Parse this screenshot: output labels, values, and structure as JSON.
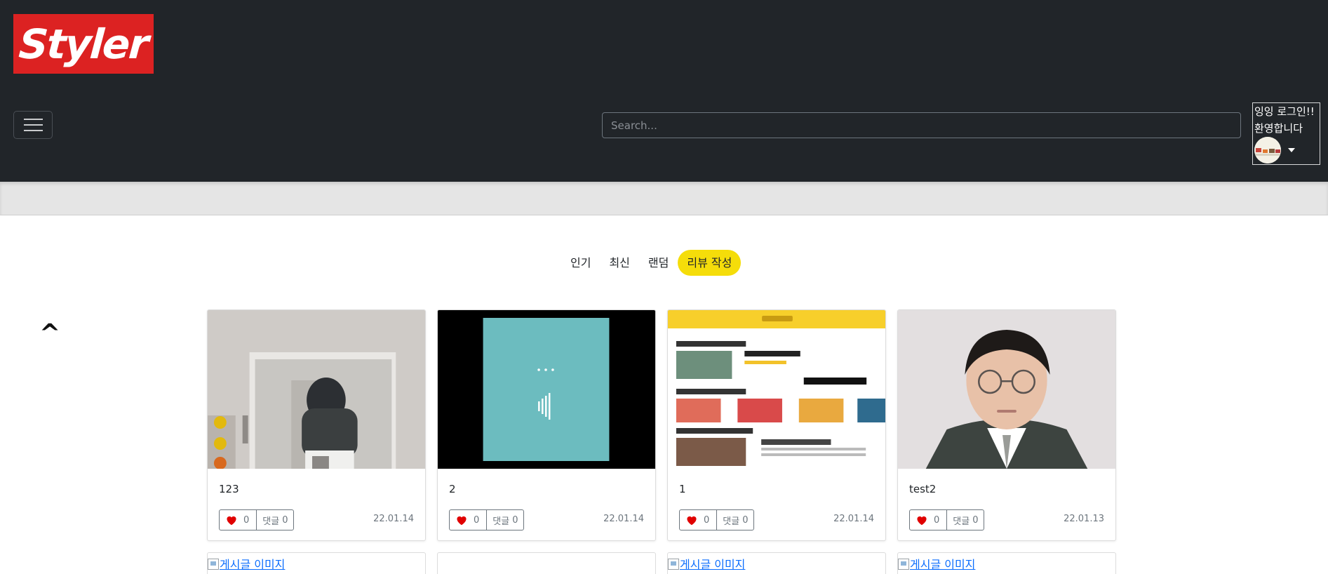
{
  "header": {
    "logo_text": "Styler",
    "search_placeholder": "Search...",
    "user_greeting_line1": "잉잉 로그인!!",
    "user_greeting_line2": "환영합니다"
  },
  "sort_tabs": [
    {
      "label": "인기",
      "active": false
    },
    {
      "label": "최신",
      "active": false
    },
    {
      "label": "랜덤",
      "active": false
    },
    {
      "label": "리뷰 작성",
      "active": true
    }
  ],
  "scroll_top_label": "^",
  "posts": [
    {
      "title": "123",
      "likes": "0",
      "comment_label": "댓글",
      "comments": "0",
      "date": "22.01.14"
    },
    {
      "title": "2",
      "likes": "0",
      "comment_label": "댓글",
      "comments": "0",
      "date": "22.01.14"
    },
    {
      "title": "1",
      "likes": "0",
      "comment_label": "댓글",
      "comments": "0",
      "date": "22.01.14"
    },
    {
      "title": "test2",
      "likes": "0",
      "comment_label": "댓글",
      "comments": "0",
      "date": "22.01.13"
    }
  ],
  "next_row": [
    {
      "alt_text": "게시글 이미지"
    },
    {
      "alt_text": ""
    },
    {
      "alt_text": "게시글 이미지"
    },
    {
      "alt_text": "게시글 이미지"
    }
  ],
  "colors": {
    "navbar": "#212529",
    "logo_bg": "#dc2222",
    "active_tab": "#f5dd0a",
    "heart": "#e00000",
    "link": "#0d6efd"
  },
  "icons": {
    "menu": "hamburger-icon",
    "like": "heart-icon",
    "dropdown": "caret-down-icon"
  }
}
